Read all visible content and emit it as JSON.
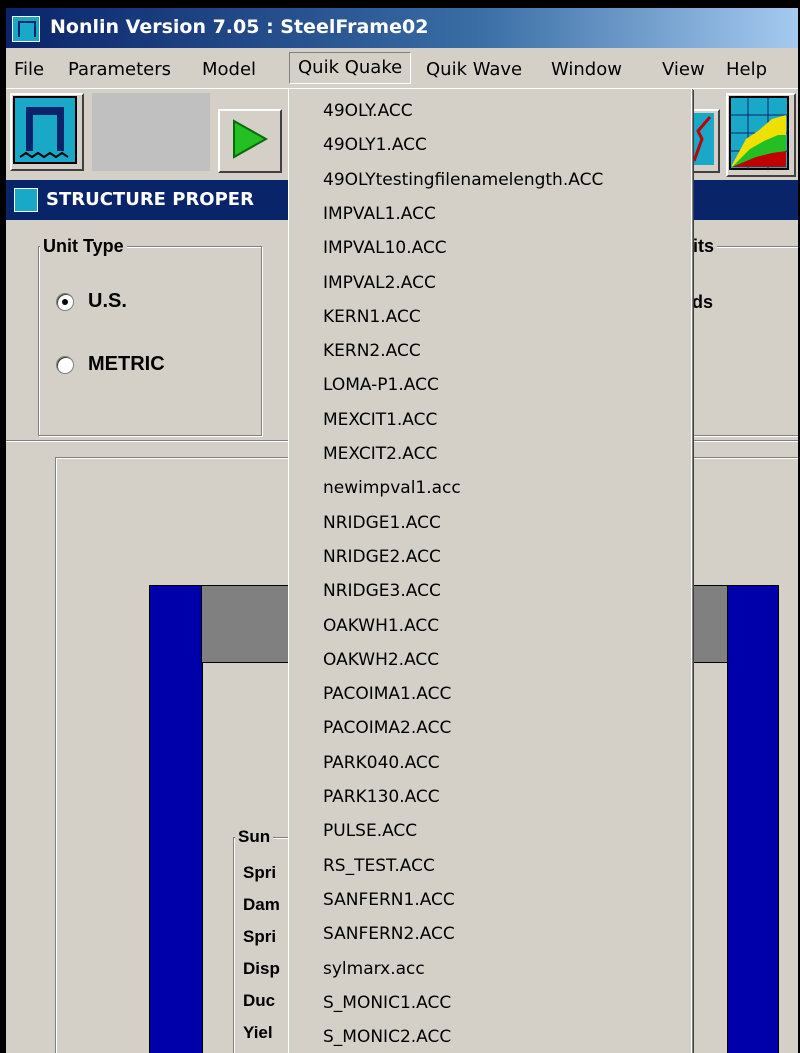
{
  "window": {
    "title": "Nonlin Version 7.05 : SteelFrame02"
  },
  "menubar": {
    "items": [
      "File",
      "Parameters",
      "Model",
      "Quik Quake",
      "Quik Wave",
      "Window",
      "View",
      "Help"
    ]
  },
  "child_window": {
    "title": "STRUCTURE PROPER"
  },
  "unit_type": {
    "label": "Unit Type",
    "options": [
      "U.S.",
      "METRIC"
    ],
    "selected": "U.S."
  },
  "units_group": {
    "label_fragment": "its",
    "option_fragment": "ds"
  },
  "summary": {
    "label_fragment": "Sun",
    "rows": [
      "Spri",
      "Dam",
      "Spri",
      "Disp",
      "Duc",
      "Yiel"
    ]
  },
  "quik_quake_menu": {
    "items": [
      "49OLY.ACC",
      "49OLY1.ACC",
      "49OLYtestingfilenamelength.ACC",
      "IMPVAL1.ACC",
      "IMPVAL10.ACC",
      "IMPVAL2.ACC",
      "KERN1.ACC",
      "KERN2.ACC",
      "LOMA-P1.ACC",
      "MEXCIT1.ACC",
      "MEXCIT2.ACC",
      "newimpval1.acc",
      "NRIDGE1.ACC",
      "NRIDGE2.ACC",
      "NRIDGE3.ACC",
      "OAKWH1.ACC",
      "OAKWH2.ACC",
      "PACOIMA1.ACC",
      "PACOIMA2.ACC",
      "PARK040.ACC",
      "PARK130.ACC",
      "PULSE.ACC",
      "RS_TEST.ACC",
      "SANFERN1.ACC",
      "SANFERN2.ACC",
      "sylmarx.acc",
      "S_MONIC1.ACC",
      "S_MONIC2.ACC"
    ]
  },
  "colors": {
    "titlebar": "#0a246a",
    "frame_column": "#0000aa",
    "frame_beam": "#808080",
    "run_icon": "#22c022"
  },
  "icons": {
    "app": "frame-icon",
    "run": "play-icon",
    "plot1": "graph-icon",
    "plot2": "spectrum-icon"
  }
}
